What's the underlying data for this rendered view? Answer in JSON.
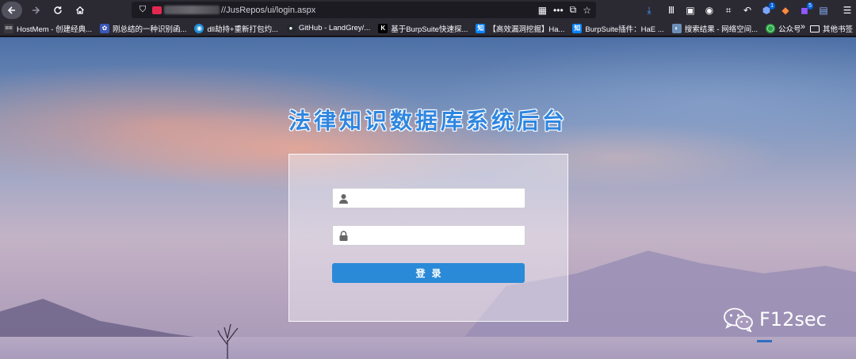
{
  "browser": {
    "url_text": "//JusRepos/ui/login.aspx",
    "extension_badges": [
      "1",
      "5"
    ]
  },
  "bookmarks": {
    "items": [
      {
        "label": "HostMem - 创建经典...",
        "icon_text": "==",
        "icon_color": "#3a3940"
      },
      {
        "label": "刚总结的一种识别函...",
        "icon_text": "✿",
        "icon_color": "#3b57b8"
      },
      {
        "label": "dll劫持+重新打包灼...",
        "icon_text": "◉",
        "icon_color": "#1f8fd6"
      },
      {
        "label": "GitHub - LandGrey/...",
        "icon_text": "●",
        "icon_color": "#24292e"
      },
      {
        "label": "基于BurpSuite快速探...",
        "icon_text": "K",
        "icon_color": "#000000"
      },
      {
        "label": "【高效漏洞挖掘】Ha...",
        "icon_text": "知",
        "icon_color": "#0a84ff"
      },
      {
        "label": "BurpSuite插件：HaE ...",
        "icon_text": "知",
        "icon_color": "#0a84ff"
      },
      {
        "label": "搜索结果 - 网络空间...",
        "icon_text": "◐",
        "icon_color": "#6c8fb8"
      },
      {
        "label": "公众号",
        "icon_text": "◯",
        "icon_color": "#2aa545"
      }
    ],
    "more_label": "»",
    "folder_label": "其他书签"
  },
  "page": {
    "title": "法律知识数据库系统后台",
    "username_placeholder": "",
    "password_placeholder": "",
    "login_label": "登录",
    "watermark_text": "F12sec"
  }
}
